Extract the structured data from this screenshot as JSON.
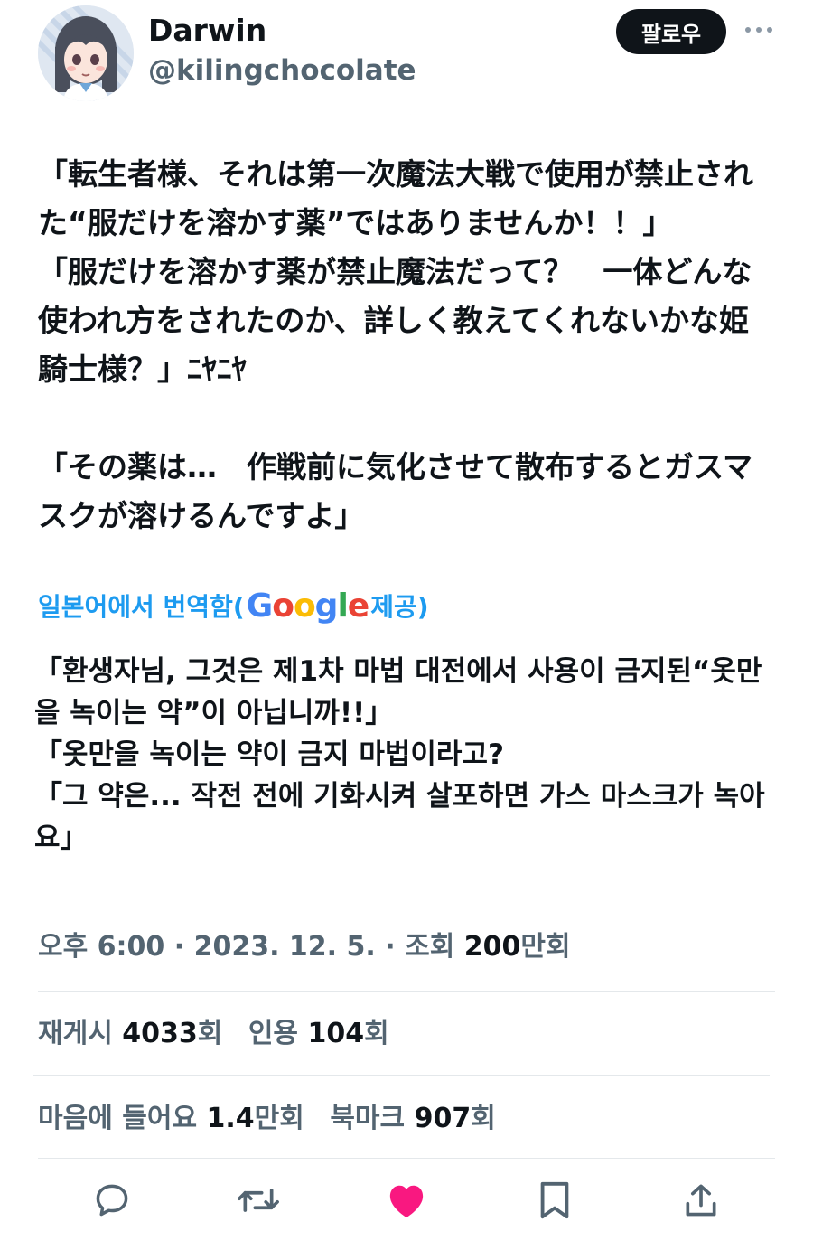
{
  "author": {
    "name": "Darwin",
    "handle": "@kilingchocolate"
  },
  "follow_label": "팔로우",
  "more_icon": "ellipsis-icon",
  "tweet_text": "「転生者様、それは第一次魔法大戦で使用が禁止された“服だけを溶かす薬”ではありませんか！！」\n「服だけを溶かす薬が禁止魔法だって？　一体どんな使われ方をされたのか、詳しく教えてくれないかな姫騎士様？」ﾆﾔﾆﾔ\n\n「その薬は…　作戦前に気化させて散布するとガスマスクが溶けるんですよ」",
  "translation": {
    "prefix": "일본어에서 번역함(",
    "provider": "Google",
    "suffix": " 제공)",
    "text": "「환생자님, 그것은 제1차 마법 대전에서 사용이 금지된“옷만을 녹이는 약”이 아닙니까!!」\n「옷만을 녹이는 약이 금지 마법이라고?\n「그 약은... 작전 전에 기화시켜 살포하면 가스 마스크가 녹아요」"
  },
  "meta": {
    "time": "오후 6:00",
    "date": "2023. 12. 5.",
    "views_label": "조회",
    "views_value": "200",
    "views_suffix": "만회",
    "separator": "·"
  },
  "stats": {
    "retweets_label": "재게시",
    "retweets_value": "4033",
    "quotes_label": "인용",
    "quotes_value": "104",
    "likes_label": "마음에 들어요",
    "likes_value": "1.4",
    "likes_unit": "만회",
    "bookmarks_label": "북마크",
    "bookmarks_value": "907",
    "count_suffix": "회"
  },
  "actions": [
    "reply-icon",
    "retweet-icon",
    "like-icon",
    "bookmark-icon",
    "share-icon"
  ],
  "colors": {
    "text": "#0f1419",
    "secondary": "#536471",
    "accent": "#1d9bf0",
    "like": "#f91880",
    "divider": "#e4e8eb"
  }
}
